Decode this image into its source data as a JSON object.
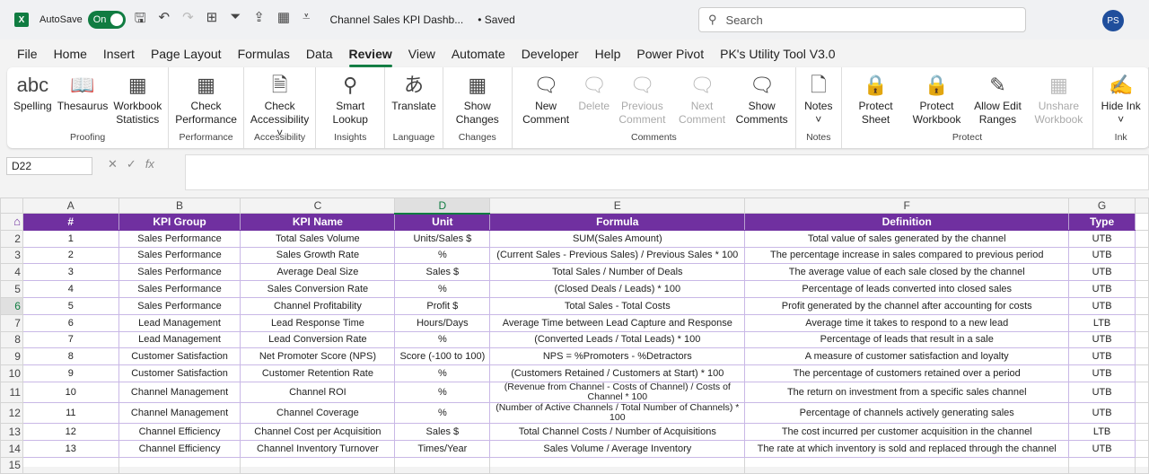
{
  "titlebar": {
    "autosave": "AutoSave",
    "toggle": "On",
    "doc_title": "Channel Sales KPI Dashb...",
    "saved": "• Saved",
    "search_placeholder": "Search",
    "avatar": "PS"
  },
  "tabs": [
    "File",
    "Home",
    "Insert",
    "Page Layout",
    "Formulas",
    "Data",
    "Review",
    "View",
    "Automate",
    "Developer",
    "Help",
    "Power Pivot",
    "PK's Utility Tool V3.0"
  ],
  "active_tab": "Review",
  "ribbon": [
    {
      "label": "Proofing",
      "buttons": [
        {
          "label": "Spelling",
          "icon": "abc"
        },
        {
          "label": "Thesaurus",
          "icon": "📖"
        },
        {
          "label": "Workbook Statistics",
          "icon": "▦"
        }
      ]
    },
    {
      "label": "Performance",
      "buttons": [
        {
          "label": "Check Performance",
          "icon": "▦"
        }
      ]
    },
    {
      "label": "Accessibility",
      "buttons": [
        {
          "label": "Check Accessibility ˅",
          "icon": "🗎"
        }
      ]
    },
    {
      "label": "Insights",
      "buttons": [
        {
          "label": "Smart Lookup",
          "icon": "⚲"
        }
      ]
    },
    {
      "label": "Language",
      "buttons": [
        {
          "label": "Translate",
          "icon": "あ"
        }
      ]
    },
    {
      "label": "Changes",
      "buttons": [
        {
          "label": "Show Changes",
          "icon": "▦"
        }
      ]
    },
    {
      "label": "Comments",
      "buttons": [
        {
          "label": "New Comment",
          "icon": "🗨"
        },
        {
          "label": "Delete",
          "icon": "🗨",
          "disabled": true
        },
        {
          "label": "Previous Comment",
          "icon": "🗨",
          "disabled": true
        },
        {
          "label": "Next Comment",
          "icon": "🗨",
          "disabled": true
        },
        {
          "label": "Show Comments",
          "icon": "🗨"
        }
      ]
    },
    {
      "label": "Notes",
      "buttons": [
        {
          "label": "Notes ˅",
          "icon": "🗋"
        }
      ]
    },
    {
      "label": "Protect",
      "buttons": [
        {
          "label": "Protect Sheet",
          "icon": "🔒"
        },
        {
          "label": "Protect Workbook",
          "icon": "🔒"
        },
        {
          "label": "Allow Edit Ranges",
          "icon": "✎"
        },
        {
          "label": "Unshare Workbook",
          "icon": "▦",
          "disabled": true
        }
      ]
    },
    {
      "label": "Ink",
      "buttons": [
        {
          "label": "Hide Ink ˅",
          "icon": "✍"
        }
      ]
    }
  ],
  "formula_bar": {
    "name_box": "D22",
    "formula": ""
  },
  "columns": [
    "A",
    "B",
    "C",
    "D",
    "E",
    "F",
    "G"
  ],
  "selected_column": "D",
  "selected_row": 6,
  "headers": [
    "#",
    "KPI Group",
    "KPI Name",
    "Unit",
    "Formula",
    "Definition",
    "Type"
  ],
  "rows": [
    [
      "1",
      "Sales Performance",
      "Total Sales Volume",
      "Units/Sales $",
      "SUM(Sales Amount)",
      "Total value of sales generated by the channel",
      "UTB"
    ],
    [
      "2",
      "Sales Performance",
      "Sales Growth Rate",
      "%",
      "(Current Sales - Previous Sales) / Previous Sales * 100",
      "The percentage increase in sales compared to previous period",
      "UTB"
    ],
    [
      "3",
      "Sales Performance",
      "Average Deal Size",
      "Sales $",
      "Total Sales / Number of Deals",
      "The average value of each sale closed by the channel",
      "UTB"
    ],
    [
      "4",
      "Sales Performance",
      "Sales Conversion Rate",
      "%",
      "(Closed Deals / Leads) * 100",
      "Percentage of leads converted into closed sales",
      "UTB"
    ],
    [
      "5",
      "Sales Performance",
      "Channel Profitability",
      "Profit $",
      "Total Sales - Total Costs",
      "Profit generated by the channel after accounting for costs",
      "UTB"
    ],
    [
      "6",
      "Lead Management",
      "Lead Response Time",
      "Hours/Days",
      "Average Time between Lead Capture and Response",
      "Average time it takes to respond to a new lead",
      "LTB"
    ],
    [
      "7",
      "Lead Management",
      "Lead Conversion Rate",
      "%",
      "(Converted Leads / Total Leads) * 100",
      "Percentage of leads that result in a sale",
      "UTB"
    ],
    [
      "8",
      "Customer Satisfaction",
      "Net Promoter Score (NPS)",
      "Score (-100 to 100)",
      "NPS = %Promoters - %Detractors",
      "A measure of customer satisfaction and loyalty",
      "UTB"
    ],
    [
      "9",
      "Customer Satisfaction",
      "Customer Retention Rate",
      "%",
      "(Customers Retained / Customers at Start) * 100",
      "The percentage of customers retained over a period",
      "UTB"
    ],
    [
      "10",
      "Channel Management",
      "Channel ROI",
      "%",
      "(Revenue from Channel - Costs of Channel) / Costs of Channel * 100",
      "The return on investment from a specific sales channel",
      "UTB"
    ],
    [
      "11",
      "Channel Management",
      "Channel Coverage",
      "%",
      "(Number of Active Channels / Total Number of Channels) * 100",
      "Percentage of channels actively generating sales",
      "UTB"
    ],
    [
      "12",
      "Channel Efficiency",
      "Channel Cost per Acquisition",
      "Sales $",
      "Total Channel Costs / Number of Acquisitions",
      "The cost incurred per customer acquisition in the channel",
      "LTB"
    ],
    [
      "13",
      "Channel Efficiency",
      "Channel Inventory Turnover",
      "Times/Year",
      "Sales Volume / Average Inventory",
      "The rate at which inventory is sold and replaced through the channel",
      "UTB"
    ]
  ],
  "colors": {
    "header_bg": "#7030a0",
    "accent": "#107c41"
  }
}
